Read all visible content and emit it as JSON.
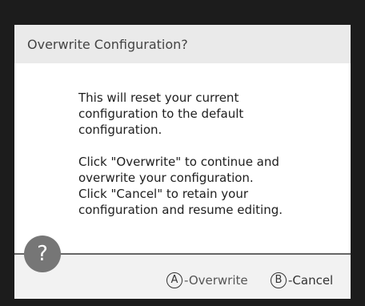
{
  "dialog": {
    "title": "Overwrite Configuration?",
    "body": {
      "paragraph1": "This will reset your current\nconfiguration to the default\nconfiguration.",
      "paragraph2": "Click \"Overwrite\" to continue and\noverwrite your configuration.\nClick \"Cancel\" to retain your\nconfiguration and resume editing."
    },
    "help_icon": {
      "glyph": "?",
      "icon": "question-mark-icon"
    },
    "buttons": {
      "overwrite": {
        "key": "A",
        "label": "-Overwrite"
      },
      "cancel": {
        "key": "B",
        "label": "-Cancel"
      }
    }
  },
  "colors": {
    "header_bg": "#eaeaea",
    "dialog_bg": "#ffffff",
    "footer_bg": "#f2f2f2",
    "help_circle": "#767676",
    "divider": "#666666"
  }
}
